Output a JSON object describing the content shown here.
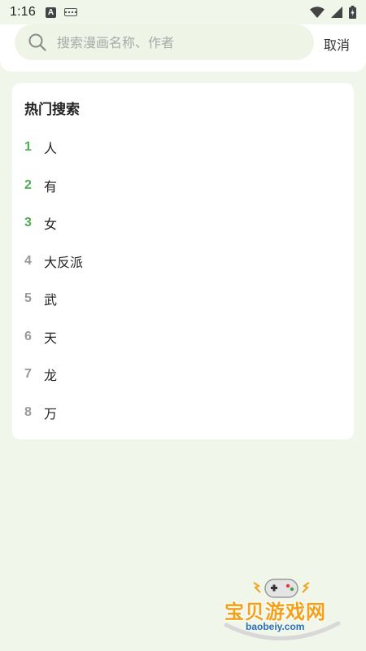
{
  "status_bar": {
    "time": "1:16"
  },
  "search": {
    "placeholder": "搜索漫画名称、作者",
    "value": "",
    "cancel_label": "取消"
  },
  "hot": {
    "title": "热门搜索",
    "accent_color": "#4caf50",
    "muted_color": "#999999",
    "items": [
      {
        "rank": "1",
        "term": "人",
        "highlight": true
      },
      {
        "rank": "2",
        "term": "有",
        "highlight": true
      },
      {
        "rank": "3",
        "term": "女",
        "highlight": true
      },
      {
        "rank": "4",
        "term": "大反派",
        "highlight": false
      },
      {
        "rank": "5",
        "term": "武",
        "highlight": false
      },
      {
        "rank": "6",
        "term": "天",
        "highlight": false
      },
      {
        "rank": "7",
        "term": "龙",
        "highlight": false
      },
      {
        "rank": "8",
        "term": "万",
        "highlight": false
      }
    ]
  },
  "watermark": {
    "name": "宝贝游戏网",
    "url": "baobeiy.com"
  }
}
